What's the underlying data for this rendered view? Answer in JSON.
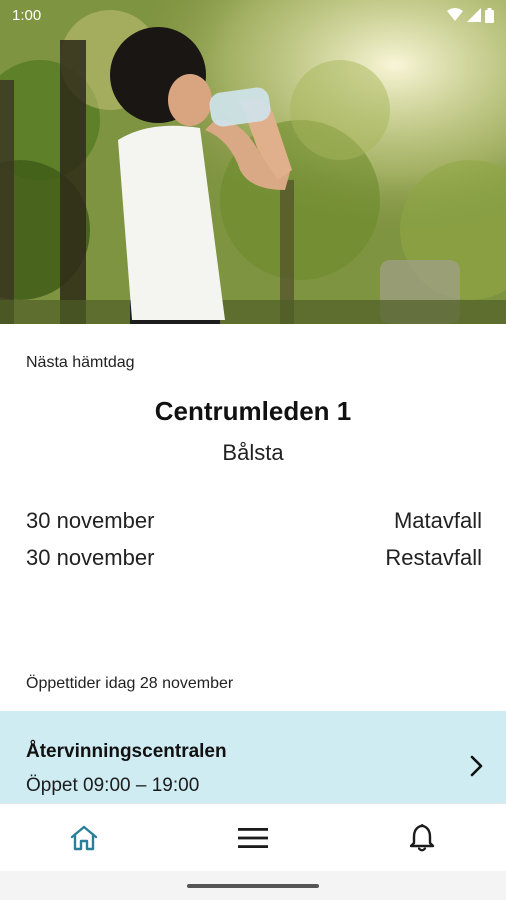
{
  "status_bar": {
    "time": "1:00"
  },
  "next_pickup": {
    "label": "Nästa hämtdag",
    "address": "Centrumleden 1",
    "city": "Bålsta",
    "items": [
      {
        "date": "30 november",
        "type": "Matavfall"
      },
      {
        "date": "30 november",
        "type": "Restavfall"
      }
    ]
  },
  "opening_hours": {
    "label": "Öppettider idag 28 november",
    "place": "Återvinningscentralen",
    "hours": "Öppet 09:00 – 19:00"
  },
  "bottom_nav": {
    "items": [
      {
        "icon": "home-icon",
        "active": true
      },
      {
        "icon": "menu-icon",
        "active": false
      },
      {
        "icon": "bell-icon",
        "active": false
      }
    ],
    "active_color": "#2a7f9a"
  }
}
